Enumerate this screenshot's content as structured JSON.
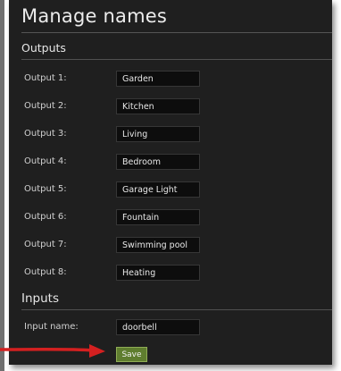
{
  "page": {
    "title": "Manage names"
  },
  "outputs": {
    "header": "Outputs",
    "items": [
      {
        "label": "Output 1:",
        "value": "Garden"
      },
      {
        "label": "Output 2:",
        "value": "Kitchen"
      },
      {
        "label": "Output 3:",
        "value": "Living"
      },
      {
        "label": "Output 4:",
        "value": "Bedroom"
      },
      {
        "label": "Output 5:",
        "value": "Garage Light"
      },
      {
        "label": "Output 6:",
        "value": "Fountain"
      },
      {
        "label": "Output 7:",
        "value": "Swimming pool"
      },
      {
        "label": "Output 8:",
        "value": "Heating"
      }
    ]
  },
  "inputs": {
    "header": "Inputs",
    "name_label": "Input name:",
    "name_value": "doorbell"
  },
  "actions": {
    "save_label": "Save"
  },
  "colors": {
    "annotation_arrow": "#d42020",
    "save_button": "#5f7d2f"
  },
  "annotation": {
    "icon": "red-arrow-icon"
  }
}
